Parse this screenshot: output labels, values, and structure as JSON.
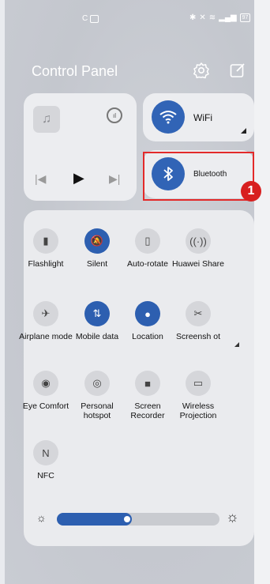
{
  "status_bar": {
    "battery": "97"
  },
  "header": {
    "title": "Control Panel"
  },
  "wifi": {
    "label": "WiFi"
  },
  "bluetooth": {
    "label": "Bluetooth"
  },
  "annotation": {
    "badge": "1",
    "highlight_color": "#e32a2a"
  },
  "tiles": [
    {
      "label": "Flashlight",
      "icon": "flashlight-icon",
      "active": false
    },
    {
      "label": "Silent",
      "icon": "bell-off-icon",
      "active": true
    },
    {
      "label": "Auto-rotate",
      "icon": "rotate-icon",
      "active": false
    },
    {
      "label": "Huawei Share",
      "icon": "share-waves-icon",
      "active": false
    },
    {
      "label": "Airplane mode",
      "icon": "airplane-icon",
      "active": false
    },
    {
      "label": "Mobile data",
      "icon": "data-arrows-icon",
      "active": true
    },
    {
      "label": "Location",
      "icon": "location-pin-icon",
      "active": true
    },
    {
      "label": "Screensh ot",
      "icon": "screenshot-icon",
      "active": false
    },
    {
      "label": "Eye Comfort",
      "icon": "eye-icon",
      "active": false
    },
    {
      "label": "Personal hotspot",
      "icon": "hotspot-icon",
      "active": false
    },
    {
      "label": "Screen Recorder",
      "icon": "record-icon",
      "active": false
    },
    {
      "label": "Wireless Projection",
      "icon": "cast-icon",
      "active": false
    },
    {
      "label": "NFC",
      "icon": "nfc-icon",
      "active": false
    }
  ],
  "brightness": {
    "level": 0.43
  },
  "colors": {
    "accent": "#2d5fb0",
    "badge": "#d81f1f"
  }
}
